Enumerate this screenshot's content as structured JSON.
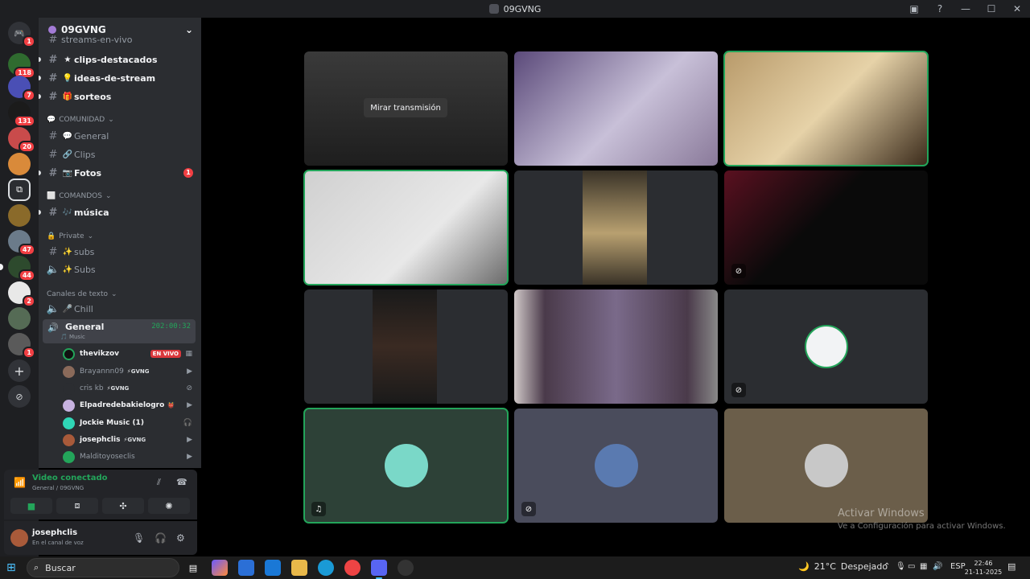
{
  "window": {
    "title": "09GVNG"
  },
  "rail": {
    "badges": [
      "1",
      "118",
      "7",
      "131",
      "20",
      "47",
      "44",
      "2",
      "1"
    ]
  },
  "guild": {
    "name": "09GVNG"
  },
  "channels": {
    "top_partial": "streams-en-vivo",
    "items": [
      {
        "emoji": "★",
        "name": "clips-destacados",
        "bold": true
      },
      {
        "emoji": "💡",
        "name": "ideas-de-stream",
        "bold": true
      },
      {
        "emoji": "🎁",
        "name": "sorteos",
        "bold": true
      }
    ],
    "cat_comunidad": "COMUNIDAD",
    "comunidad": [
      {
        "emoji": "💬",
        "name": "General"
      },
      {
        "emoji": "🔗",
        "name": "Clips"
      },
      {
        "emoji": "📷",
        "name": "Fotos",
        "badge": "1"
      }
    ],
    "cat_comandos": "COMANDOS",
    "comandos": [
      {
        "emoji": "🎶",
        "name": "música"
      }
    ],
    "cat_private": "Private",
    "private": [
      {
        "emoji": "✨",
        "name": "subs"
      },
      {
        "emoji": "✨",
        "name": "Subs"
      }
    ],
    "cat_texto": "Canales de texto",
    "chill": {
      "emoji": "🎤",
      "name": "Chill"
    },
    "active_voice": {
      "name": "General",
      "subtitle": "🎵 Music",
      "timer": "202:00:32"
    }
  },
  "voice_users": [
    {
      "name": "thevikzov",
      "tag": "",
      "bright": true,
      "live": "EN VIVO"
    },
    {
      "name": "Brayannn09",
      "tag": "⚡GVNG",
      "bright": false
    },
    {
      "name": "cris kb",
      "tag": "⚡GVNG",
      "bright": false
    },
    {
      "name": "Elpadredebakielogro",
      "tag": "👹",
      "bright": true
    },
    {
      "name": "Jockie Music (1)",
      "tag": "",
      "bright": true
    },
    {
      "name": "josephclis",
      "tag": "⚡GVNG",
      "bright": true
    },
    {
      "name": "Malditoyoseclis",
      "tag": "",
      "bright": false
    }
  ],
  "voice_panel": {
    "title": "Video conectado",
    "subtitle": "General / 09GVNG"
  },
  "user_panel": {
    "name": "josephclis",
    "status": "En el canal de voz"
  },
  "stage": {
    "watch_label": "Mirar transmisión"
  },
  "watermark": {
    "line1": "Activar Windows",
    "line2": "Ve a Configuración para activar Windows."
  },
  "taskbar": {
    "search_label": "Buscar",
    "weather_temp": "21°C",
    "weather_desc": "Despejado",
    "lang": "ESP",
    "time": "22:46",
    "date": "21-11-2025"
  },
  "colors": {
    "accent_green": "#23a55a",
    "badge_red": "#f23f43",
    "sidebar_bg": "#2b2d31",
    "rail_bg": "#1e1f22"
  }
}
